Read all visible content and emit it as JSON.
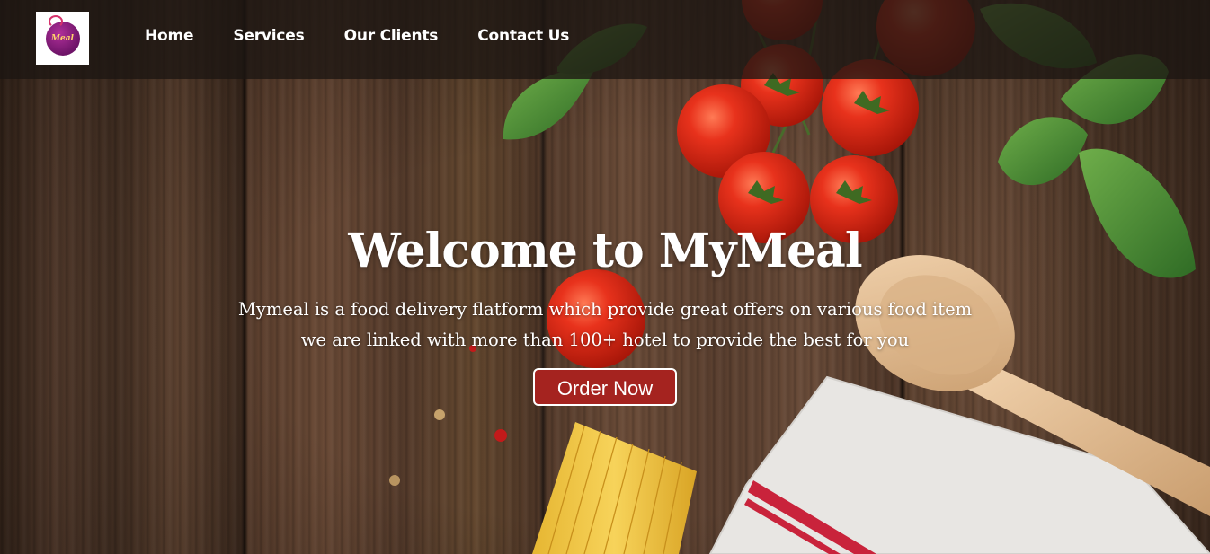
{
  "header": {
    "logo_text": "Meal",
    "nav": [
      {
        "label": "Home"
      },
      {
        "label": "Services"
      },
      {
        "label": "Our Clients"
      },
      {
        "label": "Contact Us"
      }
    ]
  },
  "hero": {
    "title": "Welcome to MyMeal",
    "description_line1": "Mymeal is a food delivery flatform which provide great offers on various food item",
    "description_line2": "we are linked with more than 100+ hotel to provide the best for you",
    "cta_label": "Order Now"
  },
  "colors": {
    "navbar_bg": "#1c1612",
    "button_bg": "#a5231f",
    "text": "#ffffff",
    "logo_badge": "#8a1c7c"
  },
  "icons": [
    "logo-icon"
  ]
}
